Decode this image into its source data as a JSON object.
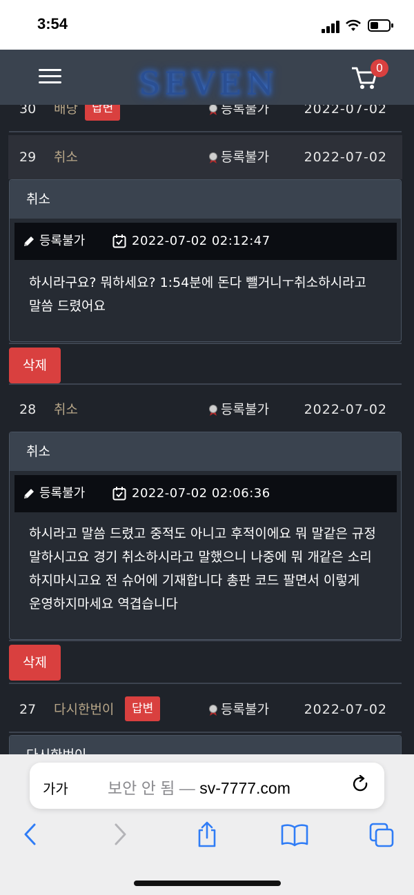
{
  "status": {
    "time": "3:54"
  },
  "header": {
    "logo": "SEVEN",
    "cart_count": "0"
  },
  "rows": [
    {
      "num": "30",
      "title": "배당",
      "tag": "답변",
      "author": "등록불가",
      "date": "2022-07-02"
    },
    {
      "num": "29",
      "title": "취소",
      "author": "등록불가",
      "date": "2022-07-02"
    },
    {
      "num": "28",
      "title": "취소",
      "author": "등록불가",
      "date": "2022-07-02"
    },
    {
      "num": "27",
      "title": "다시한번이",
      "tag": "답변",
      "author": "등록불가",
      "date": "2022-07-02"
    }
  ],
  "details": [
    {
      "title": "취소",
      "author": "등록불가",
      "datetime": "2022-07-02 02:12:47",
      "body": "하시라구요? 뭐하세요? 1:54분에 돈다 뺄거니ㅜ취소하시라고 말씀 드렸어요",
      "delete_label": "삭제"
    },
    {
      "title": "취소",
      "author": "등록불가",
      "datetime": "2022-07-02 02:06:36",
      "body": "하시라고 말씀 드렸고 중적도 아니고 후적이에요 뭐 말같은 규정 말하시고요 경기 취소하시라고 말했으니 나중에 뭐 개같은 소리 하지마시고요 전 슈어에 기재합니다 총판 코드 팔면서 이렇게 운영하지마세요 역겹습니다",
      "delete_label": "삭제"
    },
    {
      "title": "다시한번이"
    }
  ],
  "browser": {
    "aa_label": "가가",
    "url_muted": "보안 안 됨 — ",
    "url_domain": "sv-7777.com"
  },
  "icons": {
    "menu": "hamburger-icon",
    "cart": "cart-icon",
    "medal": "medal-icon",
    "pencil": "pencil-icon",
    "calendar": "calendar-icon",
    "reload": "reload-icon",
    "back": "back-icon",
    "forward": "forward-icon",
    "share": "share-icon",
    "bookmarks": "book-icon",
    "tabs": "tabs-icon"
  },
  "colors": {
    "accent_red": "#d9403f",
    "title_gold": "#b8a789",
    "logo_blue": "#2a4f93",
    "header_bg": "#3a434f",
    "page_bg": "#1f232a"
  }
}
